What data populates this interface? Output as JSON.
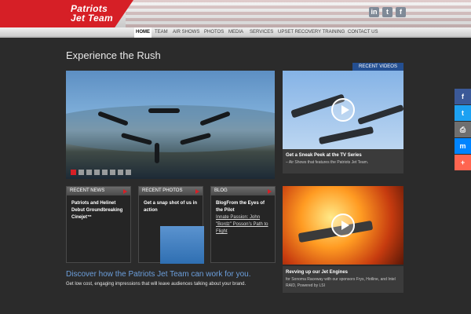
{
  "logo": {
    "line1": "Patriots",
    "line2": "Jet Team"
  },
  "social": [
    {
      "label": "in"
    },
    {
      "label": "t"
    },
    {
      "label": "f"
    }
  ],
  "nav": [
    {
      "label": "HOME"
    },
    {
      "label": "TEAM"
    },
    {
      "label": "AIR SHOWS"
    },
    {
      "label": "PHOTOS"
    },
    {
      "label": "MEDIA"
    },
    {
      "label": "SERVICES"
    },
    {
      "label": "UPSET RECOVERY TRAINING"
    },
    {
      "label": "CONTACT US"
    }
  ],
  "main": {
    "title": "Experience the Rush"
  },
  "slider": {
    "active_index": 0
  },
  "videos": {
    "tag": "RECENT VIDEOS",
    "item1": {
      "title": "Get a Sneak Peek at the TV Series",
      "desc": "– Air Shows that features the Patriots Jet Team."
    },
    "item2": {
      "title": "Revving up our Jet Engines",
      "desc": "for Sonoma Raceway with our sponsors Frys, Hotline, and Intel RAID, Powered by LSI"
    }
  },
  "boxes": [
    {
      "header": "RECENT NEWS",
      "title": "Patriots and Helinet Debut Groundbreaking Cinejet™"
    },
    {
      "header": "RECENT PHOTOS",
      "title": "Get a snap shot of us in action"
    },
    {
      "header": "BLOG",
      "title": "BlogFrom the Eyes of the Pilot",
      "link": "Innate Passion: John \"Bordz\" Posson’s Path to Flight"
    }
  ],
  "cta": {
    "title": "Discover how the Patriots Jet Team can work for you.",
    "text": "Get low cost, engaging impressions that will leave audiences talking about your brand."
  },
  "share": [
    {
      "icon": "facebook-icon",
      "label": "f",
      "color": "#3b5998"
    },
    {
      "icon": "twitter-icon",
      "label": "t",
      "color": "#1da1f2"
    },
    {
      "icon": "print-icon",
      "label": "⎙",
      "color": "#6f6f6f"
    },
    {
      "icon": "messenger-icon",
      "label": "m",
      "color": "#0084ff"
    },
    {
      "icon": "plus-icon",
      "label": "+",
      "color": "#ff6550"
    }
  ]
}
